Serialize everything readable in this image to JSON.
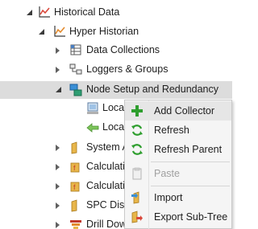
{
  "tree": {
    "historical_data": "Historical Data",
    "hyper_historian": "Hyper Historian",
    "data_collections": "Data Collections",
    "loggers_groups": "Loggers & Groups",
    "node_setup": "Node Setup and Redundancy",
    "local_1": "Local",
    "local_2": "Local",
    "system_a": "System A",
    "calculation_1": "Calculatio",
    "calculation_2": "Calculatio",
    "spc_dist": "SPC Distr",
    "drill_down": "Drill Down"
  },
  "context_menu": {
    "add_collector": "Add Collector",
    "refresh": "Refresh",
    "refresh_parent": "Refresh Parent",
    "paste": "Paste",
    "import": "Import",
    "export_subtree": "Export Sub-Tree"
  },
  "colors": {
    "selection": "#dcdcdc",
    "menu_bg": "#f5f5f5",
    "green_plus": "#2e9e2e",
    "folder_yellow": "#e8b64a"
  }
}
